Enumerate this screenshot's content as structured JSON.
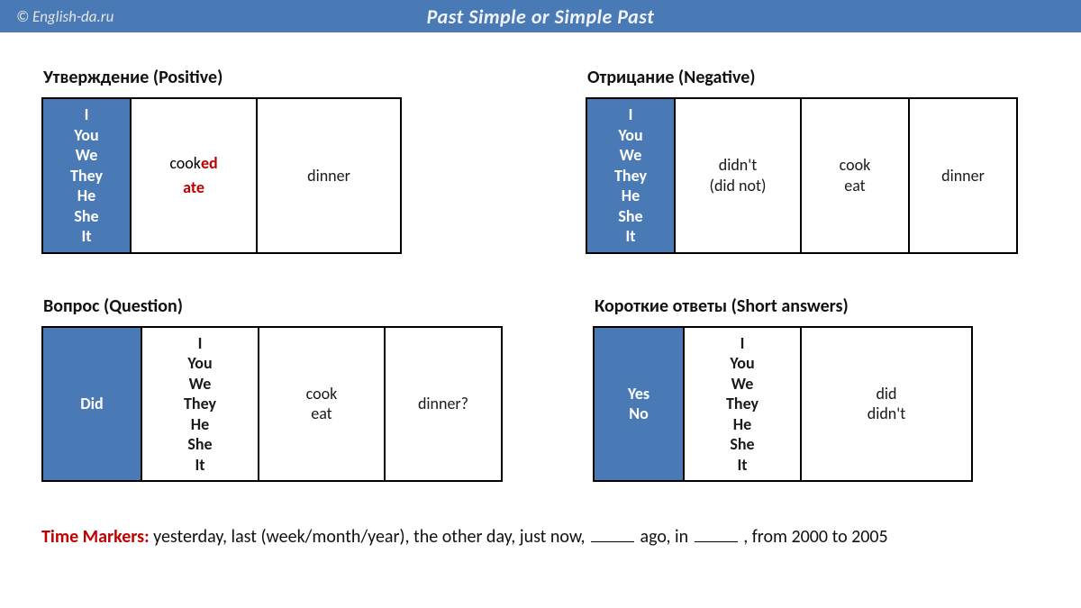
{
  "header": {
    "site": "© English-da.ru",
    "title": "Past Simple or Simple Past"
  },
  "pronouns": [
    "I",
    "You",
    "We",
    "They",
    "He",
    "She",
    "It"
  ],
  "positive": {
    "heading": "Утверждение (Positive)",
    "verb_cook_prefix": "cook",
    "verb_cook_suffix": "ed",
    "verb_ate": "ate",
    "object": "dinner"
  },
  "negative": {
    "heading": "Отрицание (Negative)",
    "aux_line1": "didn't",
    "aux_line2": "(did not)",
    "verb_cook": "cook",
    "verb_eat": "eat",
    "object": "dinner"
  },
  "question": {
    "heading": "Вопрос (Question)",
    "aux": "Did",
    "verb_cook": "cook",
    "verb_eat": "eat",
    "object": "dinner?"
  },
  "answers": {
    "heading": "Короткие ответы (Short answers)",
    "yes": "Yes",
    "no": "No",
    "did": "did",
    "didnt": "didn't"
  },
  "footer": {
    "label": "Time Markers:",
    "part1": "  yesterday, last (week/month/year), the other day, just now, ",
    "part2": " ago, in ",
    "part3": " , from 2000 to 2005"
  }
}
